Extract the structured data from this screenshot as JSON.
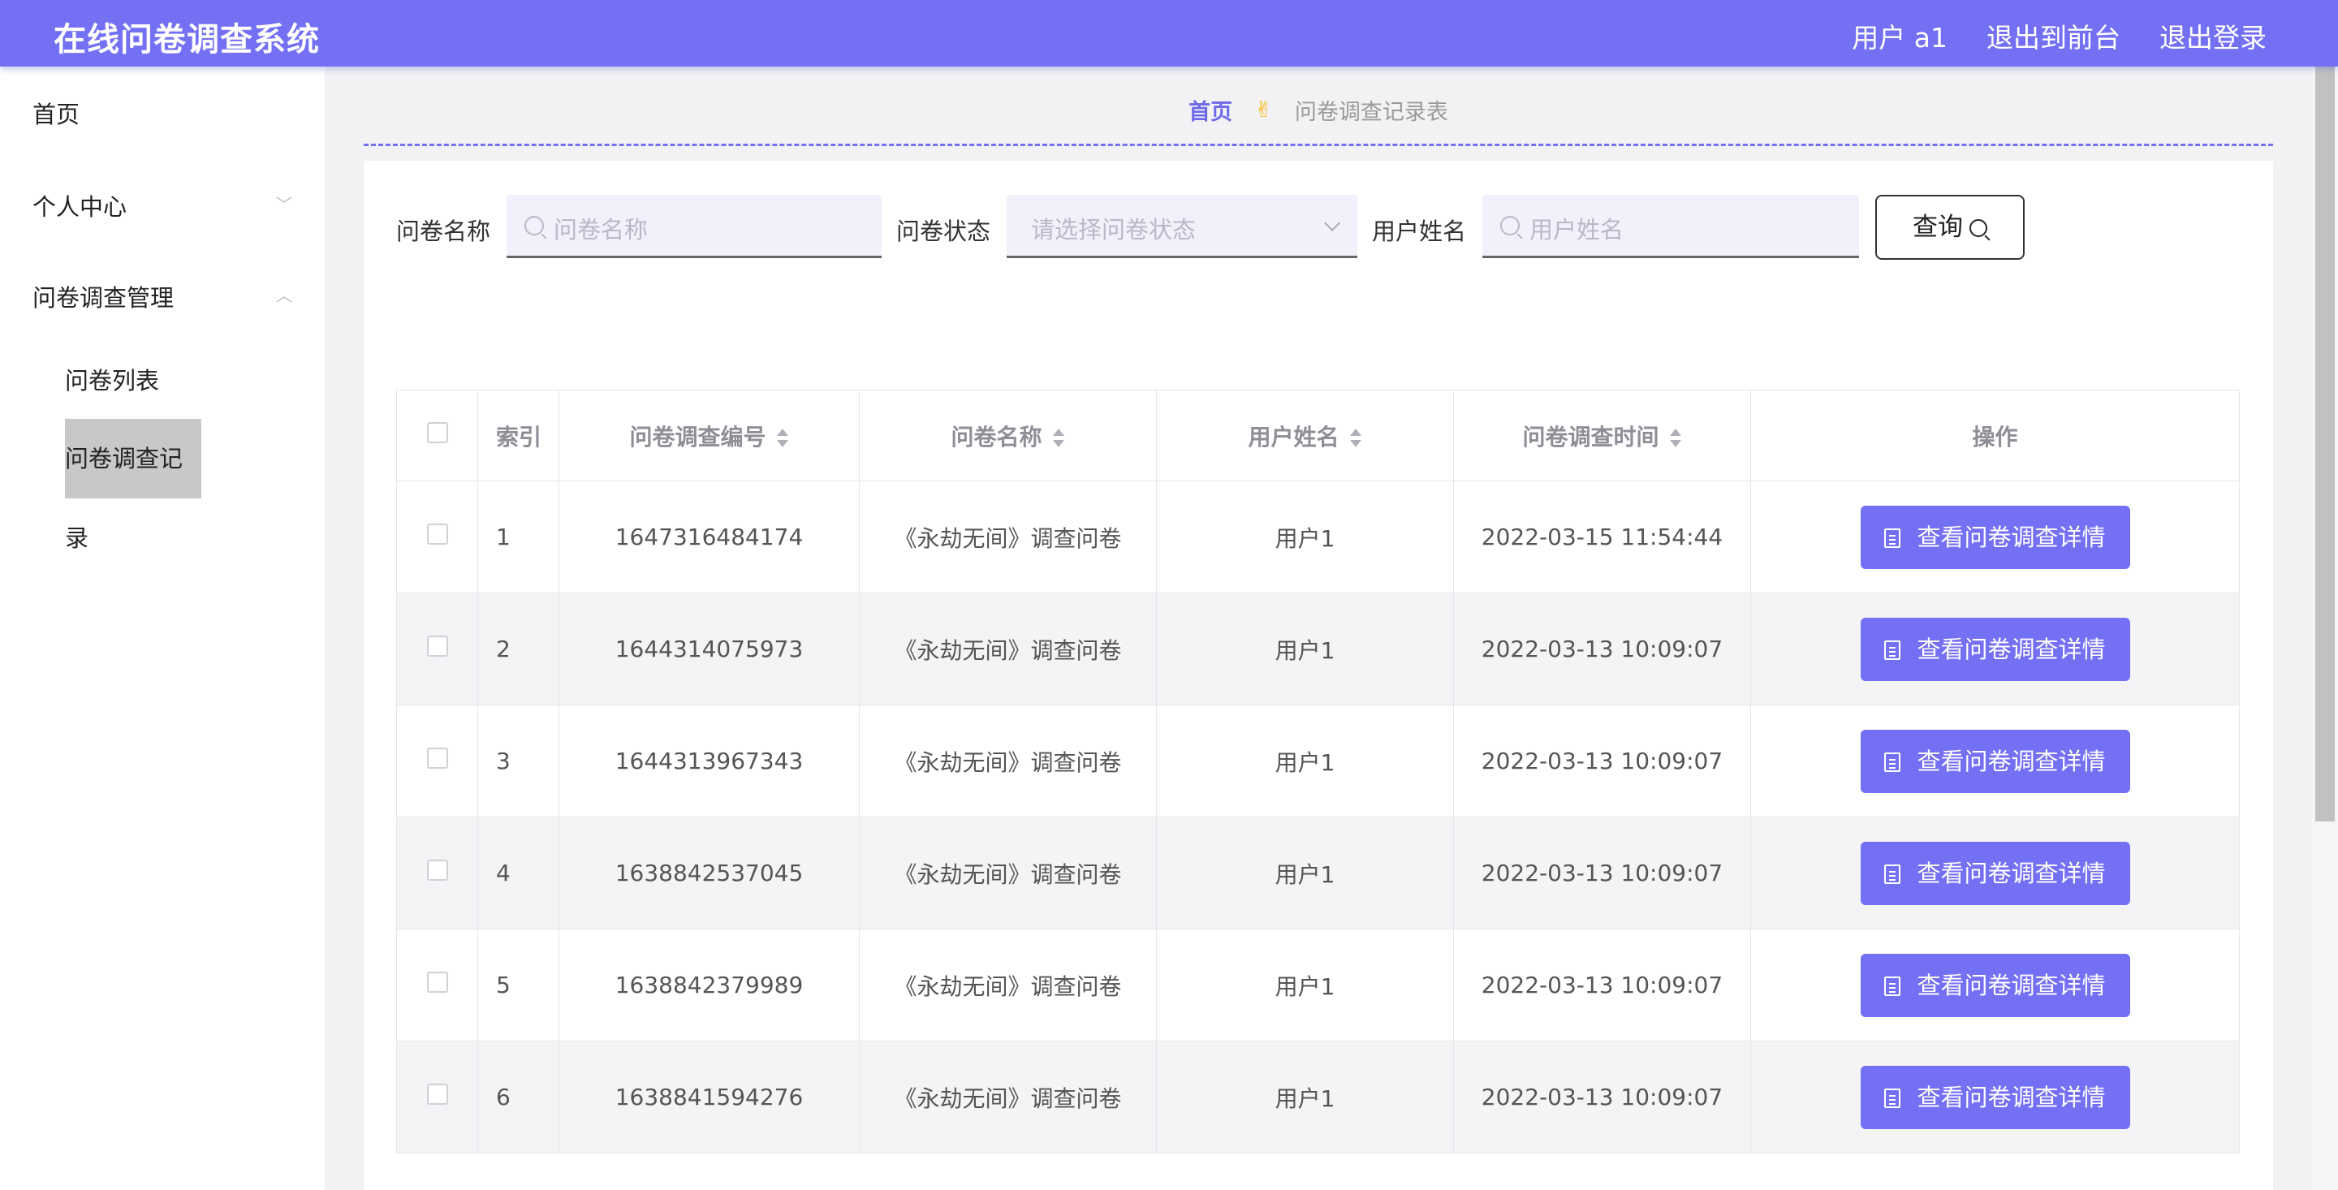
{
  "header": {
    "title": "在线问卷调查系统",
    "user_label": "用户 a1",
    "frontend_link": "退出到前台",
    "logout_link": "退出登录"
  },
  "sidebar": {
    "items": [
      {
        "label": "首页"
      },
      {
        "label": "个人中心"
      },
      {
        "label": "问卷调查管理"
      }
    ],
    "submenu": [
      {
        "label": "问卷列表"
      },
      {
        "label": "问卷调查记录"
      }
    ]
  },
  "breadcrumb": {
    "home": "首页",
    "separator": "✌",
    "current": "问卷调查记录表"
  },
  "filters": {
    "name_label": "问卷名称",
    "name_placeholder": "问卷名称",
    "status_label": "问卷状态",
    "status_placeholder": "请选择问卷状态",
    "user_label": "用户姓名",
    "user_placeholder": "用户姓名",
    "query_label": "查询"
  },
  "table": {
    "headers": {
      "index": "索引",
      "code": "问卷调查编号",
      "name": "问卷名称",
      "user": "用户姓名",
      "time": "问卷调查时间",
      "action": "操作"
    },
    "action_label": "查看问卷调查详情",
    "rows": [
      {
        "index": "1",
        "code": "1647316484174",
        "name": "《永劫无间》调查问卷",
        "user": "用户1",
        "time": "2022-03-15 11:54:44"
      },
      {
        "index": "2",
        "code": "1644314075973",
        "name": "《永劫无间》调查问卷",
        "user": "用户1",
        "time": "2022-03-13 10:09:07"
      },
      {
        "index": "3",
        "code": "1644313967343",
        "name": "《永劫无间》调查问卷",
        "user": "用户1",
        "time": "2022-03-13 10:09:07"
      },
      {
        "index": "4",
        "code": "1638842537045",
        "name": "《永劫无间》调查问卷",
        "user": "用户1",
        "time": "2022-03-13 10:09:07"
      },
      {
        "index": "5",
        "code": "1638842379989",
        "name": "《永劫无间》调查问卷",
        "user": "用户1",
        "time": "2022-03-13 10:09:07"
      },
      {
        "index": "6",
        "code": "1638841594276",
        "name": "《永劫无间》调查问卷",
        "user": "用户1",
        "time": "2022-03-13 10:09:07"
      }
    ]
  },
  "colors": {
    "accent": "#7470f3",
    "breadcrumb_home": "#6d6ae9",
    "sidebar_active_bg": "#c8c8c8"
  }
}
